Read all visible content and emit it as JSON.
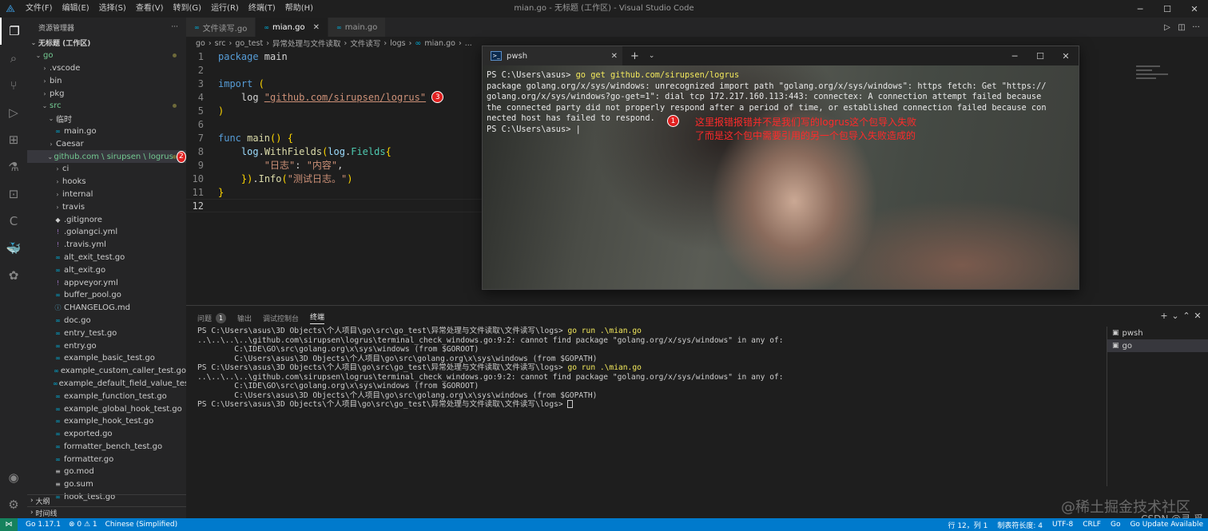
{
  "titlebar": {
    "menu": [
      "文件(F)",
      "编辑(E)",
      "选择(S)",
      "查看(V)",
      "转到(G)",
      "运行(R)",
      "终端(T)",
      "帮助(H)"
    ],
    "title": "mian.go - 无标题 (工作区) - Visual Studio Code"
  },
  "sidebar": {
    "header": "资源管理器",
    "workspace": "无标题 (工作区)",
    "tree": [
      {
        "label": "go",
        "kind": "folder-open",
        "indent": 1,
        "dot": true,
        "color": "#73c991"
      },
      {
        "label": ".vscode",
        "kind": "folder",
        "indent": 2
      },
      {
        "label": "bin",
        "kind": "folder",
        "indent": 2
      },
      {
        "label": "pkg",
        "kind": "folder",
        "indent": 2
      },
      {
        "label": "src",
        "kind": "folder-open",
        "indent": 2,
        "dot": true,
        "color": "#73c991"
      },
      {
        "label": "临时",
        "kind": "folder-open",
        "indent": 3
      },
      {
        "label": "main.go",
        "kind": "go",
        "indent": 4
      },
      {
        "label": "Caesar",
        "kind": "folder",
        "indent": 3
      },
      {
        "label": "github.com \\ sirupsen \\ logrus",
        "kind": "folder-open",
        "indent": 3,
        "dot": true,
        "color": "#73c991",
        "badge": "2",
        "selected": true
      },
      {
        "label": "ci",
        "kind": "folder",
        "indent": 4
      },
      {
        "label": "hooks",
        "kind": "folder",
        "indent": 4
      },
      {
        "label": "internal",
        "kind": "folder",
        "indent": 4
      },
      {
        "label": "travis",
        "kind": "folder",
        "indent": 4
      },
      {
        "label": ".gitignore",
        "kind": "git",
        "indent": 4
      },
      {
        "label": ".golangci.yml",
        "kind": "yml",
        "indent": 4
      },
      {
        "label": ".travis.yml",
        "kind": "yml",
        "indent": 4
      },
      {
        "label": "alt_exit_test.go",
        "kind": "go",
        "indent": 4
      },
      {
        "label": "alt_exit.go",
        "kind": "go",
        "indent": 4
      },
      {
        "label": "appveyor.yml",
        "kind": "yml",
        "indent": 4
      },
      {
        "label": "buffer_pool.go",
        "kind": "go",
        "indent": 4
      },
      {
        "label": "CHANGELOG.md",
        "kind": "md",
        "indent": 4
      },
      {
        "label": "doc.go",
        "kind": "go",
        "indent": 4
      },
      {
        "label": "entry_test.go",
        "kind": "go",
        "indent": 4
      },
      {
        "label": "entry.go",
        "kind": "go",
        "indent": 4
      },
      {
        "label": "example_basic_test.go",
        "kind": "go",
        "indent": 4
      },
      {
        "label": "example_custom_caller_test.go",
        "kind": "go",
        "indent": 4
      },
      {
        "label": "example_default_field_value_test.go",
        "kind": "go",
        "indent": 4
      },
      {
        "label": "example_function_test.go",
        "kind": "go",
        "indent": 4
      },
      {
        "label": "example_global_hook_test.go",
        "kind": "go",
        "indent": 4
      },
      {
        "label": "example_hook_test.go",
        "kind": "go",
        "indent": 4
      },
      {
        "label": "exported.go",
        "kind": "go",
        "indent": 4
      },
      {
        "label": "formatter_bench_test.go",
        "kind": "go",
        "indent": 4
      },
      {
        "label": "formatter.go",
        "kind": "go",
        "indent": 4
      },
      {
        "label": "go.mod",
        "kind": "mod",
        "indent": 4
      },
      {
        "label": "go.sum",
        "kind": "mod",
        "indent": 4
      },
      {
        "label": "hook_test.go",
        "kind": "go",
        "indent": 4
      }
    ],
    "outline": "大纲",
    "timeline": "时间线"
  },
  "tabs": [
    {
      "label": "文件读写.go",
      "active": false
    },
    {
      "label": "mian.go",
      "active": true
    },
    {
      "label": "main.go",
      "active": false
    }
  ],
  "breadcrumb": [
    "go",
    "src",
    "go_test",
    "异常处理与文件读取",
    "文件读写",
    "logs",
    "mian.go",
    "..."
  ],
  "badges": {
    "one": "1",
    "two": "2",
    "three": "3"
  },
  "terminal_window": {
    "tab": "pwsh",
    "lines": [
      "PS C:\\Users\\asus> ",
      "package golang.org/x/sys/windows: unrecognized import path \"golang.org/x/sys/windows\": https fetch: Get \"https://",
      "golang.org/x/sys/windows?go-get=1\": dial tcp 172.217.160.113:443: connectex: A connection attempt failed because",
      "the connected party did not properly respond after a period of time, or established connection failed because con",
      "nected host has failed to respond.",
      "PS C:\\Users\\asus> |"
    ],
    "command": "go get github.com/sirupsen/logrus",
    "annotation_1": "这里报错报错并不是我们写的logrus这个包导入失败",
    "annotation_2": "了而是这个包中需要引用的另一个包导入失败造成的"
  },
  "panel": {
    "tabs": [
      {
        "label": "问题",
        "count": "1"
      },
      {
        "label": "输出"
      },
      {
        "label": "调试控制台"
      },
      {
        "label": "终端",
        "active": true
      }
    ],
    "prompt": "PS C:\\Users\\asus\\3D Objects\\个人项目\\go\\src\\go_test\\异常处理与文件读取\\文件读写\\logs> ",
    "cmd": "go run .\\mian.go",
    "error1": "..\\..\\..\\..\\github.com\\sirupsen\\logrus\\terminal_check_windows.go:9:2: cannot find package \"golang.org/x/sys/windows\" in any of:",
    "error2": "        C:\\IDE\\GO\\src\\golang.org\\x\\sys\\windows (from $GOROOT)",
    "error3": "        C:\\Users\\asus\\3D Objects\\个人项目\\go\\src\\golang.org\\x\\sys\\windows (from $GOPATH)",
    "terminals": [
      "pwsh",
      "go"
    ]
  },
  "watermark": "@稀土掘金技术社区",
  "csdn": "CSDN @寻 觅",
  "statusbar": {
    "go_version": "Go 1.17.1",
    "problems": "⊗ 0 ⚠ 1",
    "language": "Chinese (Simplified)",
    "position": "行 12，列 1",
    "tab_size": "制表符长度: 4",
    "encoding": "UTF-8",
    "eol": "CRLF",
    "mode": "Go",
    "update": "Go Update Available"
  }
}
